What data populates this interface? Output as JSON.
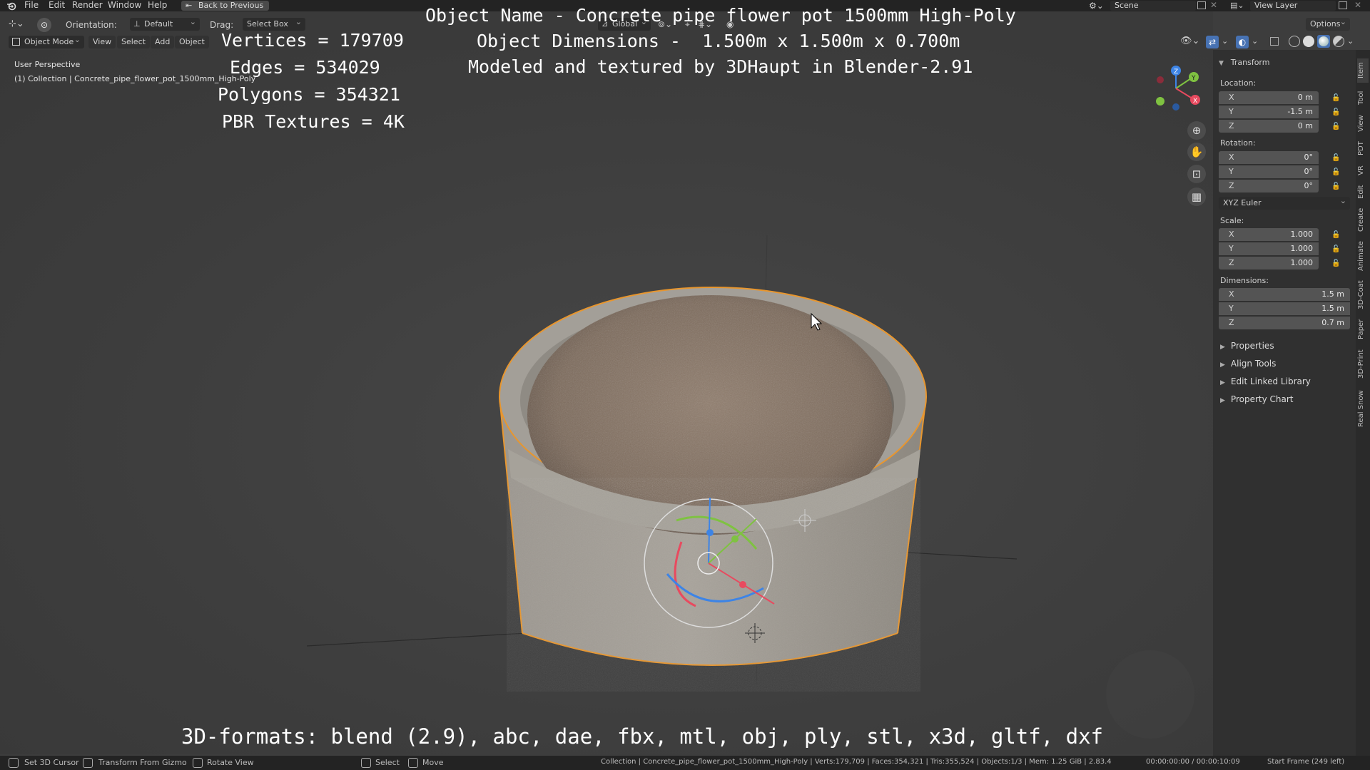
{
  "topbar": {
    "menu": [
      "File",
      "Edit",
      "Render",
      "Window",
      "Help"
    ],
    "back_button": "Back to Previous",
    "scene_label": "Scene",
    "view_layer_label": "View Layer"
  },
  "header": {
    "orientation_label": "Orientation:",
    "orientation_value": "Default",
    "drag_label": "Drag:",
    "drag_value": "Select Box",
    "transform_space": "Global",
    "options_label": "Options",
    "mode": "Object Mode",
    "menus": [
      "View",
      "Select",
      "Add",
      "Object"
    ]
  },
  "viewport": {
    "perspective": "User Perspective",
    "collection_path": "(1) Collection | Concrete_pipe_flower_pot_1500mm_High-Poly",
    "stats": {
      "vertices": "Vertices = 179709",
      "edges": "Edges = 534029",
      "polygons": "Polygons = 354321",
      "textures": "PBR Textures = 4K"
    },
    "info": {
      "name": "Object Name - Concrete pipe flower pot 1500mm High-Poly",
      "dimensions": "Object Dimensions -  1.500m x 1.500m x 0.700m",
      "credit": "Modeled and textured by 3DHaupt in Blender-2.91"
    },
    "formats": "3D-formats: blend (2.9), abc, dae, fbx, mtl, obj, ply, stl, x3d, gltf, dxf"
  },
  "npanel": {
    "transform_title": "Transform",
    "location_label": "Location:",
    "location": [
      {
        "axis": "X",
        "value": "0 m"
      },
      {
        "axis": "Y",
        "value": "-1.5 m"
      },
      {
        "axis": "Z",
        "value": "0 m"
      }
    ],
    "rotation_label": "Rotation:",
    "rotation": [
      {
        "axis": "X",
        "value": "0°"
      },
      {
        "axis": "Y",
        "value": "0°"
      },
      {
        "axis": "Z",
        "value": "0°"
      }
    ],
    "rotation_mode": "XYZ Euler",
    "scale_label": "Scale:",
    "scale": [
      {
        "axis": "X",
        "value": "1.000"
      },
      {
        "axis": "Y",
        "value": "1.000"
      },
      {
        "axis": "Z",
        "value": "1.000"
      }
    ],
    "dimensions_label": "Dimensions:",
    "dimensions": [
      {
        "axis": "X",
        "value": "1.5 m"
      },
      {
        "axis": "Y",
        "value": "1.5 m"
      },
      {
        "axis": "Z",
        "value": "0.7 m"
      }
    ],
    "collapsed": [
      "Properties",
      "Align Tools",
      "Edit Linked Library",
      "Property Chart"
    ]
  },
  "tabs": [
    "Item",
    "Tool",
    "View",
    "PDT",
    "VR",
    "Edit",
    "Create",
    "Animate",
    "3D-Coat",
    "Paper",
    "3D-Print",
    "Real Snow"
  ],
  "statusbar": {
    "left": [
      "Set 3D Cursor",
      "Transform From Gizmo",
      "Rotate View"
    ],
    "mid": [
      "Select",
      "Move"
    ],
    "info": "Collection | Concrete_pipe_flower_pot_1500mm_High-Poly | Verts:179,709 | Faces:354,321 | Tris:355,524 | Objects:1/3 | Mem: 1.25 GiB | 2.83.4",
    "time": "00:00:00:00 / 00:00:10:09",
    "frame": "Start Frame (249 left)"
  },
  "colors": {
    "selection_outline": "#e8962e",
    "axis_x": "#e84a5f",
    "axis_y": "#7fc241",
    "axis_z": "#3d84e6"
  }
}
